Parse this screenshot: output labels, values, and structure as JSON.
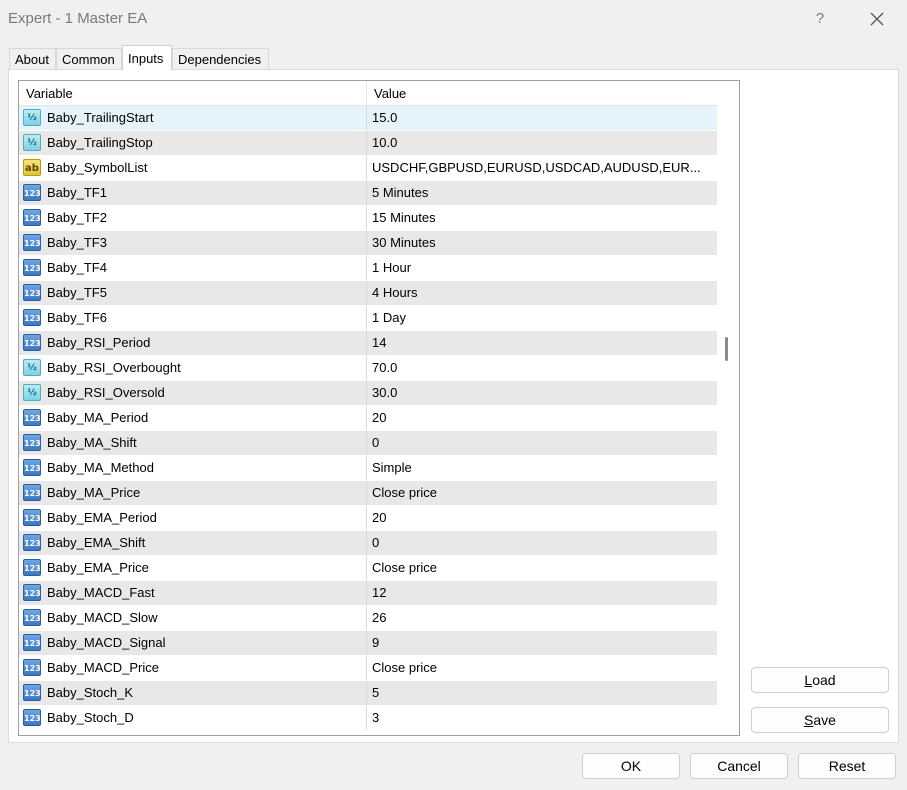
{
  "window": {
    "title": "Expert - 1 Master EA",
    "help_label": "?"
  },
  "tabs": [
    {
      "label": "About"
    },
    {
      "label": "Common"
    },
    {
      "label": "Inputs"
    },
    {
      "label": "Dependencies"
    }
  ],
  "grid": {
    "headers": {
      "variable": "Variable",
      "value": "Value"
    },
    "rows": [
      {
        "type": "double-icon",
        "name": "Baby_TrailingStart",
        "value": "15.0"
      },
      {
        "type": "double-icon",
        "name": "Baby_TrailingStop",
        "value": "10.0"
      },
      {
        "type": "string-icon",
        "name": "Baby_SymbolList",
        "value": "USDCHF,GBPUSD,EURUSD,USDCAD,AUDUSD,EUR..."
      },
      {
        "type": "int-icon",
        "name": "Baby_TF1",
        "value": "5 Minutes"
      },
      {
        "type": "int-icon",
        "name": "Baby_TF2",
        "value": "15 Minutes"
      },
      {
        "type": "int-icon",
        "name": "Baby_TF3",
        "value": "30 Minutes"
      },
      {
        "type": "int-icon",
        "name": "Baby_TF4",
        "value": "1 Hour"
      },
      {
        "type": "int-icon",
        "name": "Baby_TF5",
        "value": "4 Hours"
      },
      {
        "type": "int-icon",
        "name": "Baby_TF6",
        "value": "1 Day"
      },
      {
        "type": "int-icon",
        "name": "Baby_RSI_Period",
        "value": "14"
      },
      {
        "type": "double-icon",
        "name": "Baby_RSI_Overbought",
        "value": "70.0"
      },
      {
        "type": "double-icon",
        "name": "Baby_RSI_Oversold",
        "value": "30.0"
      },
      {
        "type": "int-icon",
        "name": "Baby_MA_Period",
        "value": "20"
      },
      {
        "type": "int-icon",
        "name": "Baby_MA_Shift",
        "value": "0"
      },
      {
        "type": "int-icon",
        "name": "Baby_MA_Method",
        "value": "Simple"
      },
      {
        "type": "int-icon",
        "name": "Baby_MA_Price",
        "value": "Close price"
      },
      {
        "type": "int-icon",
        "name": "Baby_EMA_Period",
        "value": "20"
      },
      {
        "type": "int-icon",
        "name": "Baby_EMA_Shift",
        "value": "0"
      },
      {
        "type": "int-icon",
        "name": "Baby_EMA_Price",
        "value": "Close price"
      },
      {
        "type": "int-icon",
        "name": "Baby_MACD_Fast",
        "value": "12"
      },
      {
        "type": "int-icon",
        "name": "Baby_MACD_Slow",
        "value": "26"
      },
      {
        "type": "int-icon",
        "name": "Baby_MACD_Signal",
        "value": "9"
      },
      {
        "type": "int-icon",
        "name": "Baby_MACD_Price",
        "value": "Close price"
      },
      {
        "type": "int-icon",
        "name": "Baby_Stoch_K",
        "value": "5"
      },
      {
        "type": "int-icon",
        "name": "Baby_Stoch_D",
        "value": "3"
      }
    ]
  },
  "side_buttons": {
    "load": {
      "mnemonic": "L",
      "rest": "oad"
    },
    "save": {
      "mnemonic": "S",
      "rest": "ave"
    }
  },
  "footer": {
    "ok_label": "OK",
    "cancel_label": "Cancel",
    "reset_label": "Reset"
  },
  "icon_glyphs": {
    "int-icon": "123",
    "double-icon": "½",
    "string-icon": "ab"
  }
}
